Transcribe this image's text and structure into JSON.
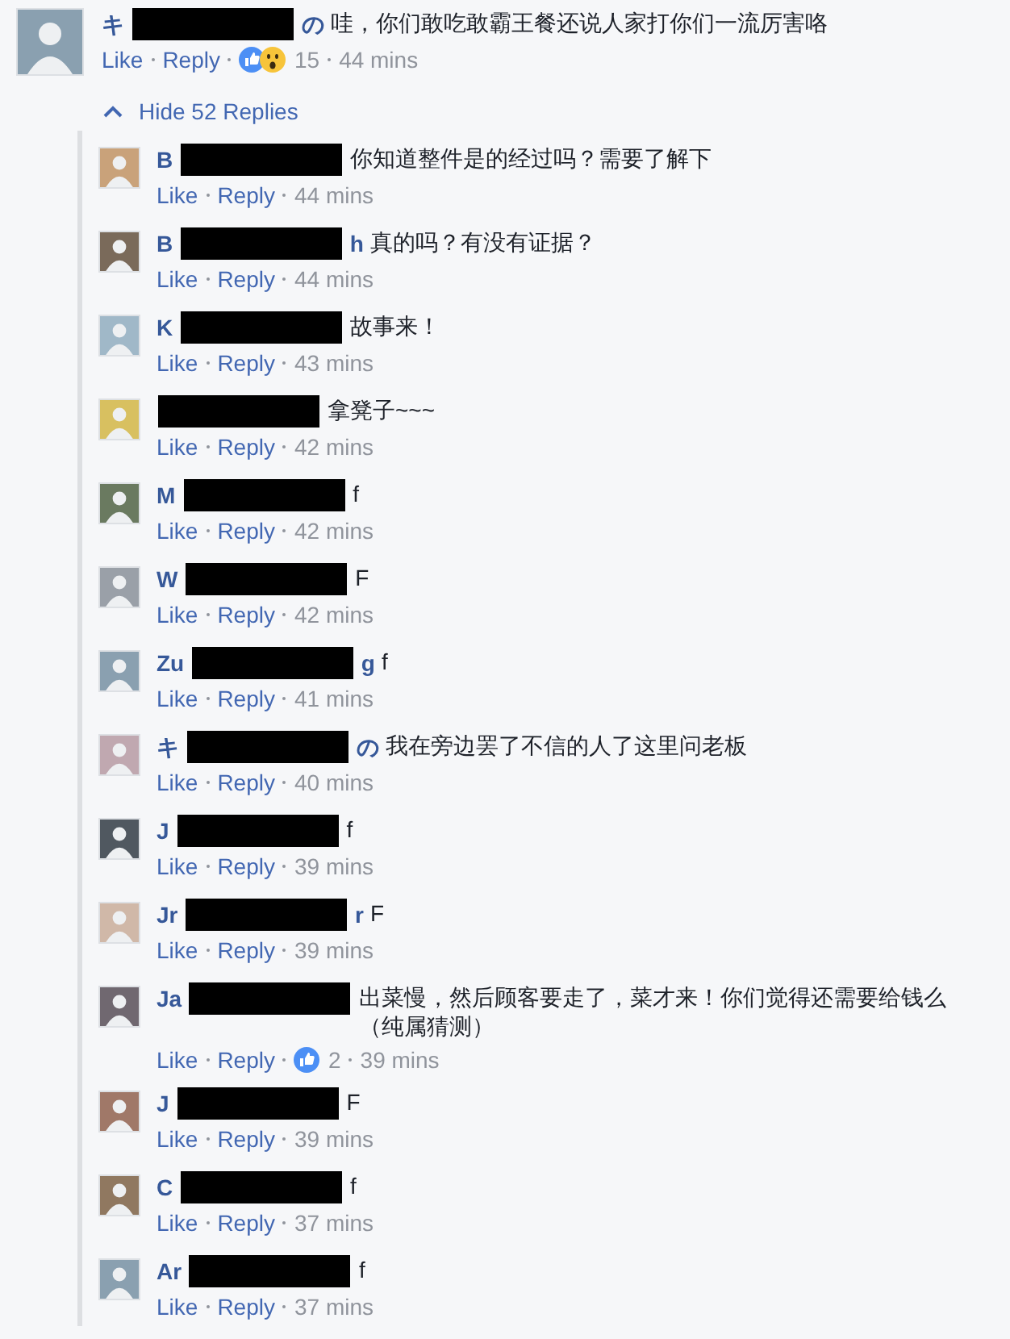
{
  "comment": {
    "author_start": "キ",
    "author_end": "の",
    "text": "哇，你们敢吃敢霸王餐还说人家打你们一流厉害咯",
    "actions": [
      "Like",
      "Reply"
    ],
    "reactions": [
      {
        "kind": "like"
      },
      {
        "kind": "wow"
      }
    ],
    "reaction_count": "15",
    "time": "44 mins"
  },
  "toggle": "Hide 52 Replies",
  "replies": [
    {
      "author_start": "B",
      "text": "你知道整件是的经过吗？需要了解下",
      "actions": [
        "Like",
        "Reply"
      ],
      "time": "44 mins"
    },
    {
      "author_start": "B",
      "author_end": "h",
      "text": "真的吗？有没有证据？",
      "actions": [
        "Like",
        "Reply"
      ],
      "time": "44 mins"
    },
    {
      "author_start": "K",
      "text": "故事来！",
      "actions": [
        "Like",
        "Reply"
      ],
      "time": "43 mins"
    },
    {
      "text": "拿凳子~~~",
      "actions": [
        "Like",
        "Reply"
      ],
      "time": "42 mins"
    },
    {
      "author_start": "M",
      "text": "f",
      "actions": [
        "Like",
        "Reply"
      ],
      "time": "42 mins"
    },
    {
      "author_start": "W",
      "text": "F",
      "actions": [
        "Like",
        "Reply"
      ],
      "time": "42 mins"
    },
    {
      "author_start": "Zu",
      "author_end": "g",
      "text": "f",
      "actions": [
        "Like",
        "Reply"
      ],
      "time": "41 mins"
    },
    {
      "author_start": "キ",
      "author_end": "の",
      "text": "我在旁边罢了不信的人了这里问老板",
      "actions": [
        "Like",
        "Reply"
      ],
      "time": "40 mins"
    },
    {
      "author_start": "J",
      "text": "f",
      "actions": [
        "Like",
        "Reply"
      ],
      "time": "39 mins"
    },
    {
      "author_start": "Jr",
      "author_end": "r",
      "text": "F",
      "actions": [
        "Like",
        "Reply"
      ],
      "time": "39 mins"
    },
    {
      "author_start": "Ja",
      "text": "出菜慢，然后顾客要走了，菜才来！你们觉得还需要给钱么（纯属猜测）",
      "actions": [
        "Like",
        "Reply"
      ],
      "reactions": [
        {
          "kind": "like"
        }
      ],
      "reaction_count": "2",
      "time": "39 mins"
    },
    {
      "author_start": "J",
      "text": "F",
      "actions": [
        "Like",
        "Reply"
      ],
      "time": "39 mins"
    },
    {
      "author_start": "C",
      "text": "f",
      "actions": [
        "Like",
        "Reply"
      ],
      "time": "37 mins"
    },
    {
      "author_start": "Ar",
      "text": "f",
      "actions": [
        "Like",
        "Reply"
      ],
      "time": "37 mins"
    }
  ]
}
